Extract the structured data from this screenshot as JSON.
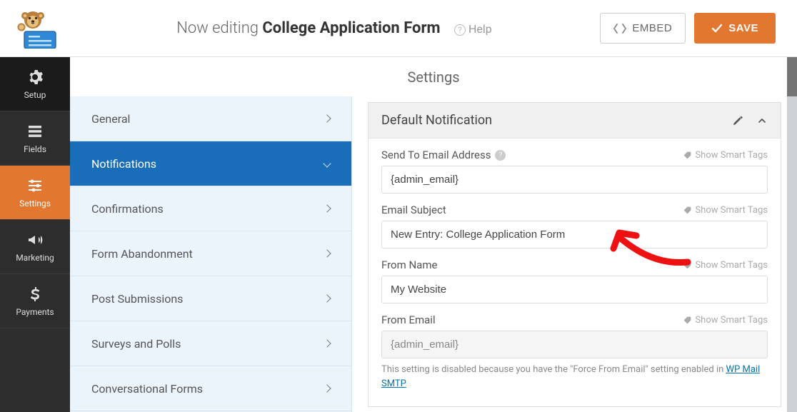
{
  "top": {
    "now_editing_prefix": "Now editing",
    "form_name": "College Application Form",
    "help_text": "Help",
    "embed_label": "EMBED",
    "save_label": "SAVE"
  },
  "sidebar": {
    "items": [
      {
        "label": "Setup"
      },
      {
        "label": "Fields"
      },
      {
        "label": "Settings"
      },
      {
        "label": "Marketing"
      },
      {
        "label": "Payments"
      }
    ]
  },
  "page_title": "Settings",
  "settings_menu": {
    "items": [
      {
        "label": "General"
      },
      {
        "label": "Notifications"
      },
      {
        "label": "Confirmations"
      },
      {
        "label": "Form Abandonment"
      },
      {
        "label": "Post Submissions"
      },
      {
        "label": "Surveys and Polls"
      },
      {
        "label": "Conversational Forms"
      }
    ],
    "active_index": 1
  },
  "panel": {
    "title": "Default Notification",
    "smart_tags_label": "Show Smart Tags",
    "fields": {
      "send_to": {
        "label": "Send To Email Address",
        "value": "{admin_email}"
      },
      "subject": {
        "label": "Email Subject",
        "value": "New Entry: College Application Form"
      },
      "from_name": {
        "label": "From Name",
        "value": "My Website"
      },
      "from_email": {
        "label": "From Email",
        "value": "{admin_email}"
      }
    },
    "from_email_note_prefix": "This setting is disabled because you have the \"Force From Email\" setting enabled in ",
    "from_email_note_link": "WP Mail SMTP"
  }
}
